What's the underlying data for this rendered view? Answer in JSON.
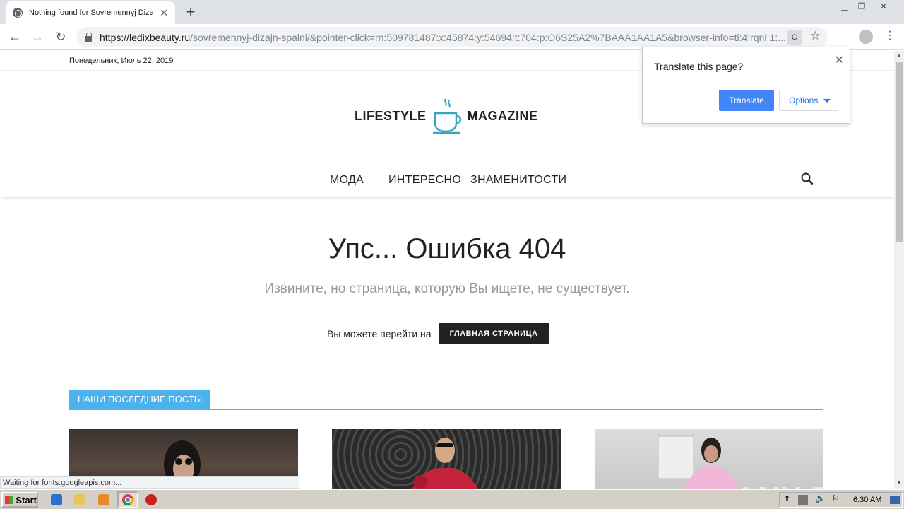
{
  "browser": {
    "tab_title": "Nothing found for Sovremennyj Dizajn",
    "new_tab_symbol": "+",
    "tab_close": "✕",
    "url_domain": "https://ledixbeauty.ru",
    "url_rest": "/sovremennyj-dizajn-spalni/&pointer-click=rn:509781487:x:45874:y:54694:t:704:p:O6S25A2%7BAAA1AA1A5&browser-info=ti:4:rqnl:1:...",
    "status_text": "Waiting for fonts.googleapis.com..."
  },
  "translate_popup": {
    "title": "Translate this page?",
    "translate_label": "Translate",
    "options_label": "Options",
    "close": "✕"
  },
  "site": {
    "date": "Понедельник, Июль 22, 2019",
    "logo_left": "LIFESTYLE",
    "logo_right": "MAGAZINE",
    "nav": [
      "МОДА",
      "ИНТЕРЕСНО",
      "ЗНАМЕНИТОСТИ"
    ],
    "error_title": "Упс... Ошибка 404",
    "error_subtitle": "Извините, но страница, которую Вы ищете, не существует.",
    "goto_text": "Вы можете перейти на",
    "home_button": "ГЛАВНАЯ СТРАНИЦА",
    "posts_heading": "НАШИ ПОСЛЕДНИЕ ПОСТЫ"
  },
  "watermark": "ANY RUN",
  "taskbar": {
    "start_label": "Start",
    "clock": "6:30 AM"
  },
  "colors": {
    "accent": "#4db2ec",
    "translate_button": "#4285f4"
  }
}
